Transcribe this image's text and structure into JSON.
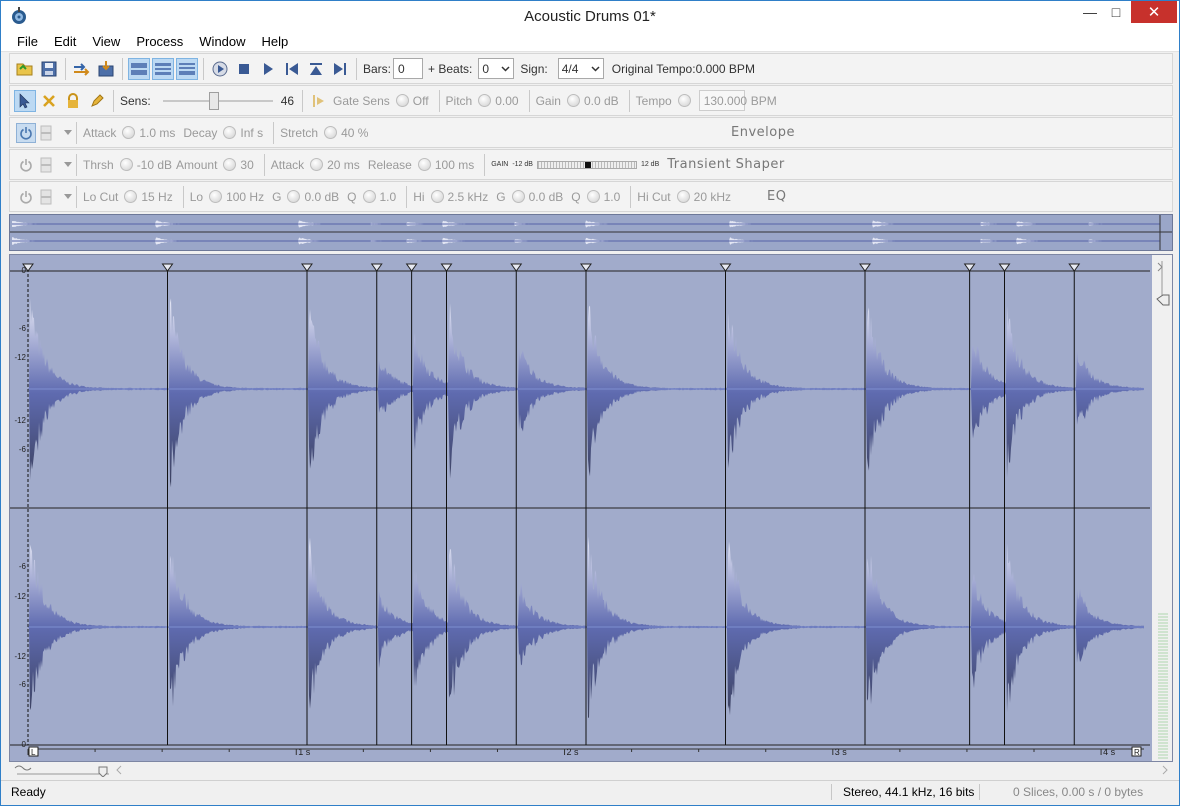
{
  "window": {
    "title": "Acoustic Drums 01*",
    "minimize_glyph": "—",
    "maximize_glyph": "□",
    "close_glyph": "✕"
  },
  "menu": [
    "File",
    "Edit",
    "View",
    "Process",
    "Window",
    "Help"
  ],
  "transport": {
    "bars_label": "Bars:",
    "bars_value": "0",
    "beats_label": "+ Beats:",
    "beats_value": "0",
    "sign_label": "Sign:",
    "sign_value": "4/4",
    "tempo_text": "Original Tempo:0.000 BPM"
  },
  "slice_row": {
    "sens_label": "Sens:",
    "sens_value": "46",
    "sens_level": 0.46,
    "gate_label": "Gate Sens",
    "gate_value": "Off",
    "pitch_label": "Pitch",
    "pitch_value": "0.00",
    "gain_label": "Gain",
    "gain_value": "0.0 dB",
    "tempo_label": "Tempo",
    "tempo_value": "130.000",
    "tempo_unit": "BPM"
  },
  "envelope": {
    "attack_label": "Attack",
    "attack_value": "1.0 ms",
    "decay_label": "Decay",
    "decay_value": "Inf s",
    "stretch_label": "Stretch",
    "stretch_value": "40 %",
    "title": "Envelope"
  },
  "transient": {
    "thrsh_label": "Thrsh",
    "thrsh_value": "-10 dB",
    "amount_label": "Amount",
    "amount_value": "30",
    "attack_label": "Attack",
    "attack_value": "20 ms",
    "release_label": "Release",
    "release_value": "100 ms",
    "gain_label": "GAIN",
    "gain_min": "-12 dB",
    "gain_max": "12 dB",
    "gain_level": 0.5,
    "title": "Transient Shaper"
  },
  "eq": {
    "locut_label": "Lo Cut",
    "locut_value": "15 Hz",
    "lo_label": "Lo",
    "lo_value": "100 Hz",
    "lo_g_label": "G",
    "lo_g_value": "0.0 dB",
    "lo_q_label": "Q",
    "lo_q_value": "1.0",
    "hi_label": "Hi",
    "hi_value": "2.5 kHz",
    "hi_g_label": "G",
    "hi_g_value": "0.0 dB",
    "hi_q_label": "Q",
    "hi_q_value": "1.0",
    "hicut_label": "Hi Cut",
    "hicut_value": "20 kHz",
    "title": "EQ"
  },
  "waveform": {
    "db_labels_top": [
      "0",
      "-6",
      "-12",
      "-12",
      "-6"
    ],
    "db_labels_bottom": [
      "-6",
      "-12",
      "-12",
      "-6",
      "0"
    ],
    "time_labels": [
      "1 s",
      "2 s",
      "3 s",
      "4 s"
    ],
    "loop_start": "L",
    "loop_end": "R",
    "slice_times_s": [
      0.0,
      0.52,
      1.04,
      1.3,
      1.43,
      1.56,
      1.82,
      2.08,
      2.6,
      3.12,
      3.51,
      3.64,
      3.9
    ],
    "hit_amplitudes": [
      0.85,
      0.85,
      0.8,
      0.3,
      0.55,
      0.8,
      0.45,
      0.8,
      0.85,
      0.8,
      0.55,
      0.75,
      0.4
    ],
    "duration_s": 4.16,
    "colors": {
      "background": "#a1abcb",
      "wave_light": "#e7e9f6",
      "wave_dark": "#3a3f5c",
      "wave_mid": "#5f6bb0"
    }
  },
  "status": {
    "ready": "Ready",
    "format": "Stereo, 44.1 kHz, 16 bits",
    "slices": "0 Slices, 0.00 s / 0 bytes"
  }
}
